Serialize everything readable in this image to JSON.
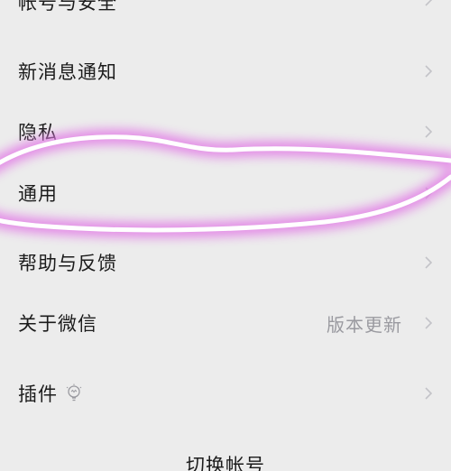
{
  "settings": {
    "items": [
      {
        "label": "帐号与安全"
      },
      {
        "label": "新消息通知"
      },
      {
        "label": "隐私"
      },
      {
        "label": "通用"
      },
      {
        "label": "帮助与反馈"
      },
      {
        "label": "关于微信",
        "meta": "版本更新"
      },
      {
        "label": "插件",
        "icon": "lightbulb-icon"
      }
    ],
    "switch_account": "切换帐号"
  },
  "annotation": {
    "color": "#e27be6",
    "icon": "highlight-scribble"
  },
  "colors": {
    "background": "#ececec",
    "text": "#1c1c1c",
    "secondary_text": "#9a9aa0",
    "chevron": "#c3c3c8"
  }
}
